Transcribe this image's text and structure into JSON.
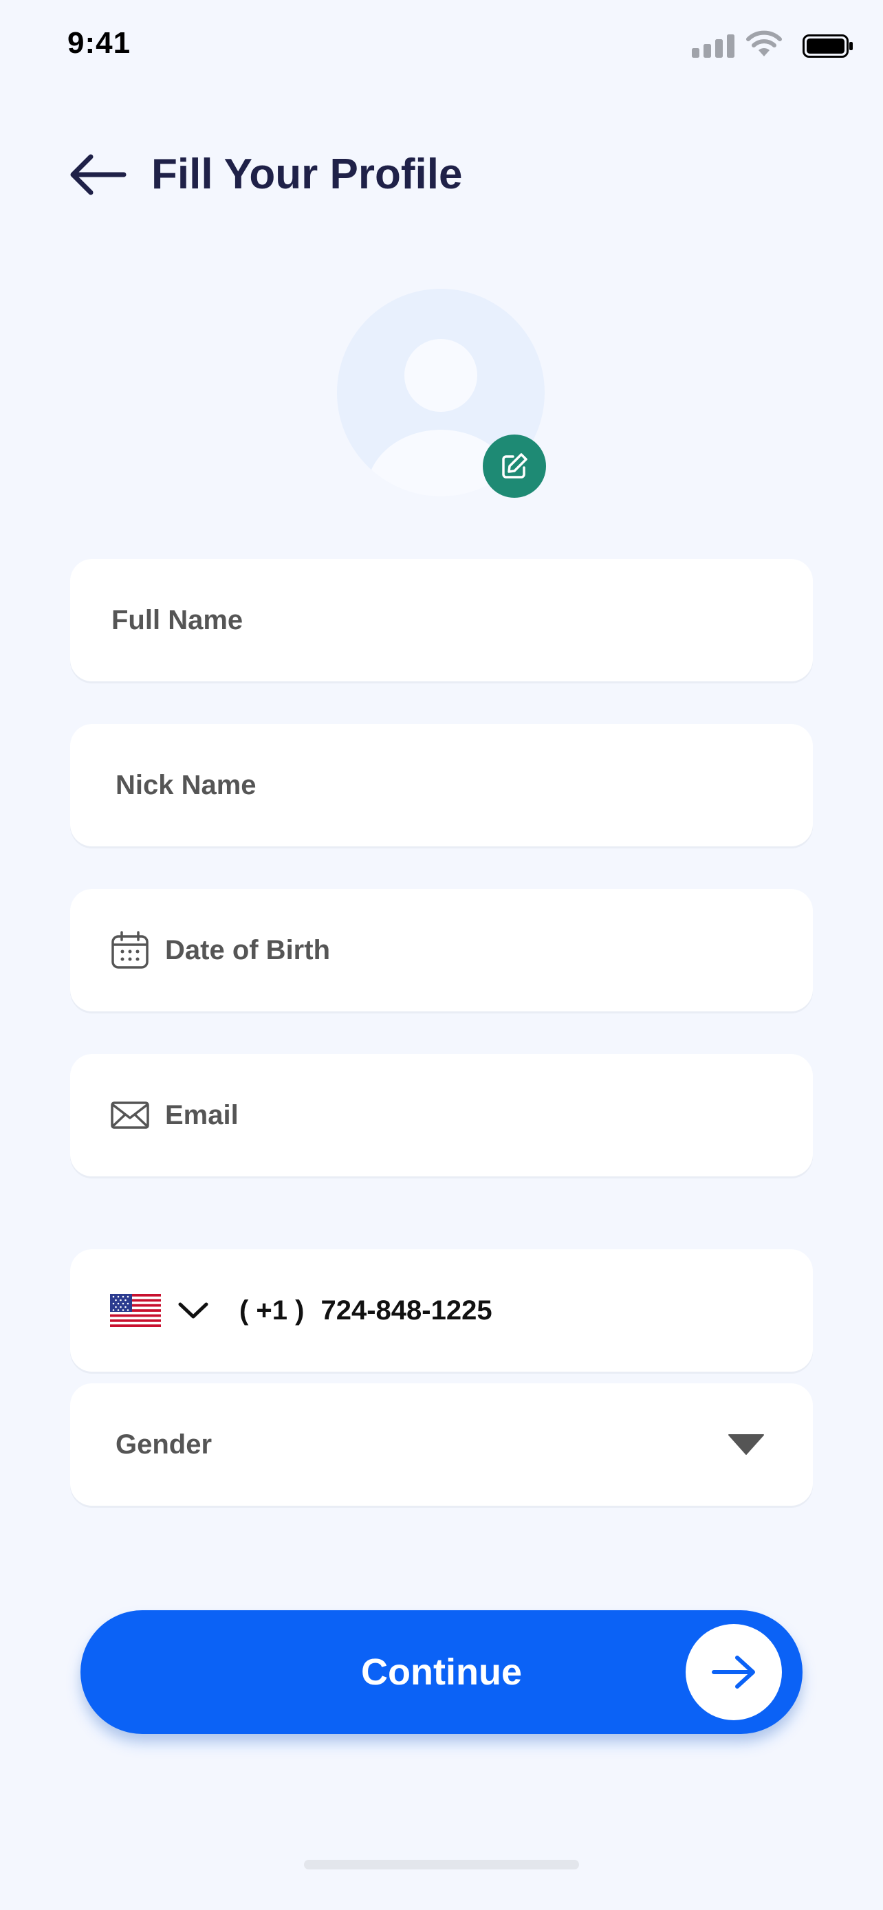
{
  "status_bar": {
    "time": "9:41",
    "icons": [
      "cellular-signal-icon",
      "wifi-icon",
      "battery-icon"
    ]
  },
  "header": {
    "back_icon": "arrow-left-icon",
    "title": "Fill Your Profile"
  },
  "avatar": {
    "icon": "user-placeholder-icon",
    "edit_icon": "edit-pencil-icon"
  },
  "form": {
    "full_name_placeholder": "Full Name",
    "nick_name_placeholder": "Nick Name",
    "dob_placeholder": "Date of Birth",
    "dob_icon": "calendar-icon",
    "email_placeholder": "Email",
    "email_icon": "mail-icon",
    "phone": {
      "country_flag": "us-flag-icon",
      "dropdown_icon": "chevron-down-icon",
      "code": "( +1 )",
      "number": "724-848-1225"
    },
    "gender_placeholder": "Gender",
    "gender_icon": "triangle-down-icon"
  },
  "continue_button": {
    "label": "Continue",
    "icon": "arrow-right-icon"
  },
  "colors": {
    "background": "#F4F7FE",
    "title": "#1F2148",
    "primary": "#0B62F6",
    "edit_badge": "#1E8A74",
    "field_bg": "#FFFFFF",
    "placeholder_text": "#555555"
  }
}
